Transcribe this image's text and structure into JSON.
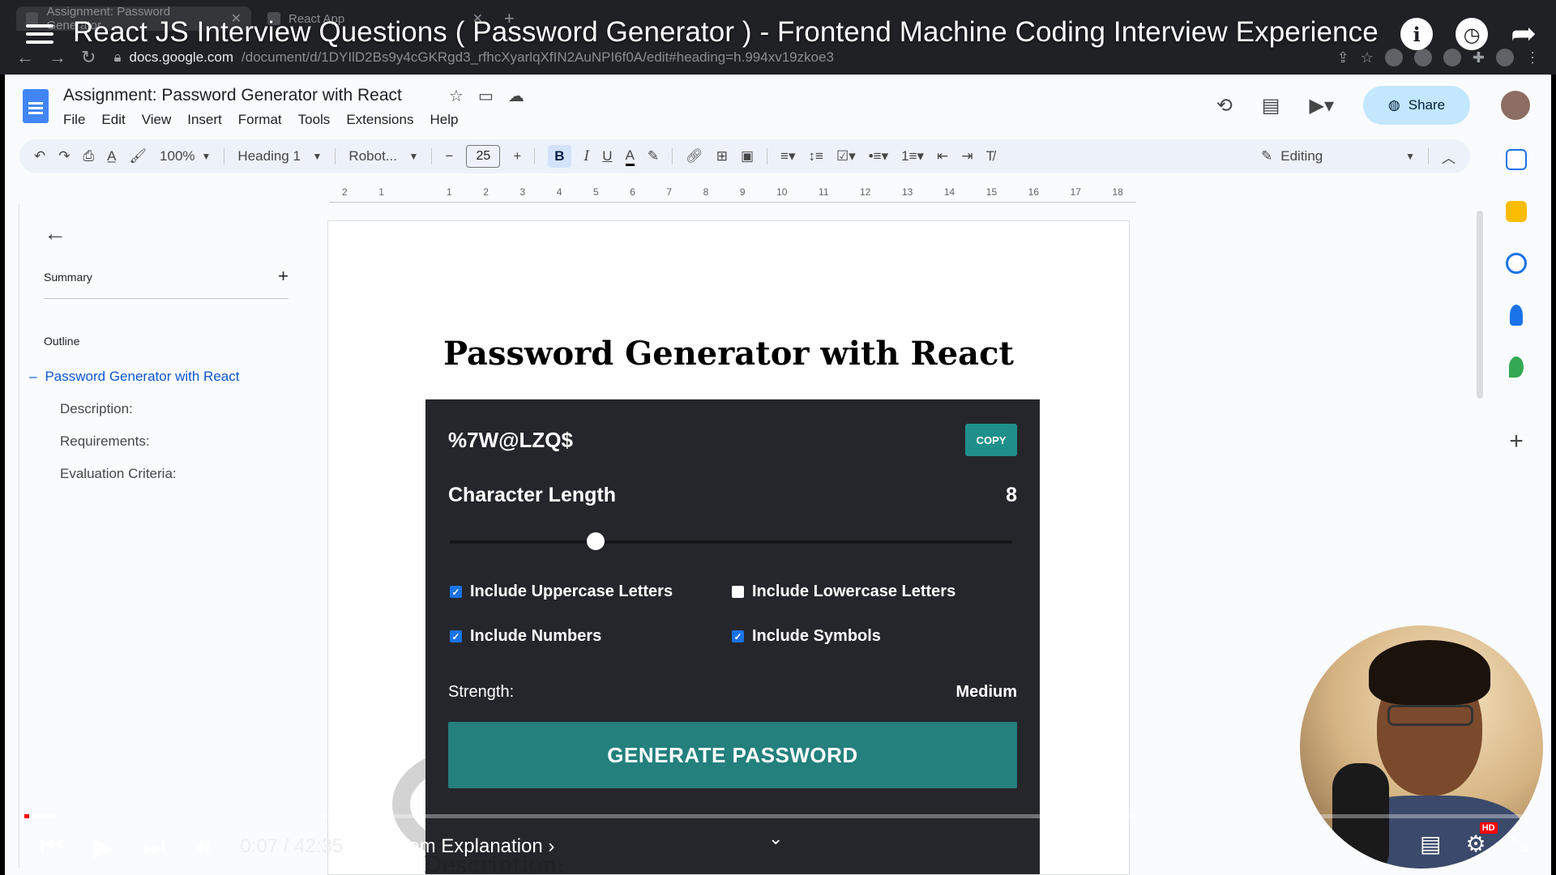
{
  "browser": {
    "tabs": [
      {
        "label": "Assignment: Password Generator"
      },
      {
        "label": "React App"
      }
    ],
    "url_host": "docs.google.com",
    "url_rest": "/document/d/1DYIlD2Bs9y4cGKRgd3_rfhcXyarlqXfIN2AuNPI6f0A/edit#heading=h.994xv19zkoe3"
  },
  "video": {
    "title": "React JS Interview Questions ( Password Generator ) - Frontend Machine Coding Interview Experience",
    "time": "0:07 / 42:35",
    "chapter": "• Problem Explanation ›",
    "progress_fraction": 0.003,
    "buffer_fraction": 0.02
  },
  "docs": {
    "title": "Assignment: Password Generator with React",
    "menu": [
      "File",
      "Edit",
      "View",
      "Insert",
      "Format",
      "Tools",
      "Extensions",
      "Help"
    ],
    "share_label": "Share",
    "toolbar": {
      "zoom": "100%",
      "style": "Heading 1",
      "font": "Robot...",
      "font_size": "25",
      "mode": "Editing"
    },
    "ruler": [
      "2",
      "1",
      "",
      "1",
      "2",
      "3",
      "4",
      "5",
      "6",
      "7",
      "8",
      "9",
      "10",
      "11",
      "12",
      "13",
      "14",
      "15",
      "16",
      "17",
      "18"
    ],
    "outline": {
      "summary": "Summary",
      "outline_label": "Outline",
      "active": "Password Generator with React",
      "items": [
        "Description:",
        "Requirements:",
        "Evaluation Criteria:"
      ]
    },
    "page": {
      "heading": "Password Generator with React",
      "next_heading": "Description:"
    }
  },
  "app": {
    "password": "%7W@LZQ$",
    "copy_label": "COPY",
    "length_label": "Character Length",
    "length_value": "8",
    "slider_fraction": 0.26,
    "options": [
      {
        "label": "Include Uppercase Letters",
        "checked": true
      },
      {
        "label": "Include Lowercase Letters",
        "checked": false
      },
      {
        "label": "Include Numbers",
        "checked": true
      },
      {
        "label": "Include Symbols",
        "checked": true
      }
    ],
    "strength_label": "Strength:",
    "strength_value": "Medium",
    "generate_label": "GENERATE PASSWORD"
  },
  "colors": {
    "app_bg": "#25262b",
    "accent_teal": "#23807c",
    "checkbox_blue": "#1a73e8",
    "share_bg": "#c2e7ff",
    "progress_red": "#ff0000"
  }
}
